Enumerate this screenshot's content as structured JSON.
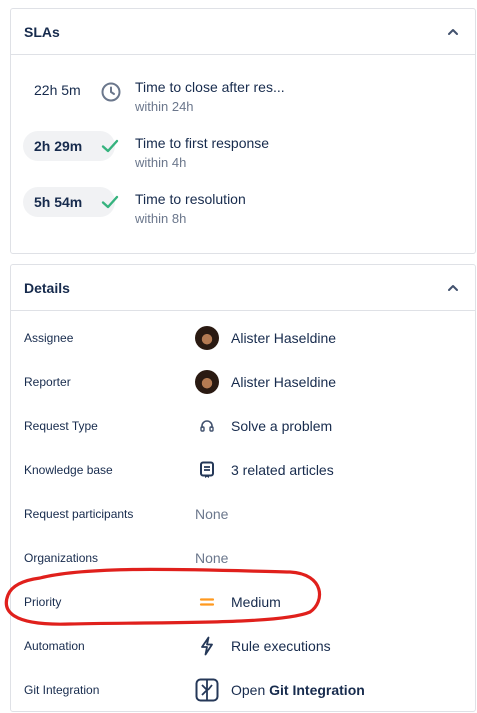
{
  "sla": {
    "title": "SLAs",
    "items": [
      {
        "time": "22h 5m",
        "status": "running",
        "icon": "clock-icon",
        "name": "Time to close after res...",
        "target": "within 24h"
      },
      {
        "time": "2h 29m",
        "status": "met",
        "icon": "check-icon",
        "name": "Time to first response",
        "target": "within 4h"
      },
      {
        "time": "5h 54m",
        "status": "met",
        "icon": "check-icon",
        "name": "Time to resolution",
        "target": "within 8h"
      }
    ]
  },
  "details": {
    "title": "Details",
    "rows": [
      {
        "label": "Assignee",
        "value": "Alister Haseldine",
        "icon": "avatar"
      },
      {
        "label": "Reporter",
        "value": "Alister Haseldine",
        "icon": "avatar"
      },
      {
        "label": "Request Type",
        "value": "Solve a problem",
        "icon": "headset-icon"
      },
      {
        "label": "Knowledge base",
        "value": "3 related articles",
        "icon": "book-icon"
      },
      {
        "label": "Request participants",
        "value": "None",
        "icon": ""
      },
      {
        "label": "Organizations",
        "value": "None",
        "icon": ""
      },
      {
        "label": "Priority",
        "value": "Medium",
        "icon": "priority-medium-icon"
      },
      {
        "label": "Automation",
        "value": "Rule executions",
        "icon": "lightning-icon"
      },
      {
        "label": "Git Integration",
        "value_prefix": "Open",
        "value_bold": "Git Integration",
        "icon": "git-integration-icon"
      }
    ]
  },
  "colors": {
    "check": "#36b37e",
    "clock": "#6b778c",
    "priority_medium": "#ff991f",
    "annotation": "#e0201c"
  }
}
